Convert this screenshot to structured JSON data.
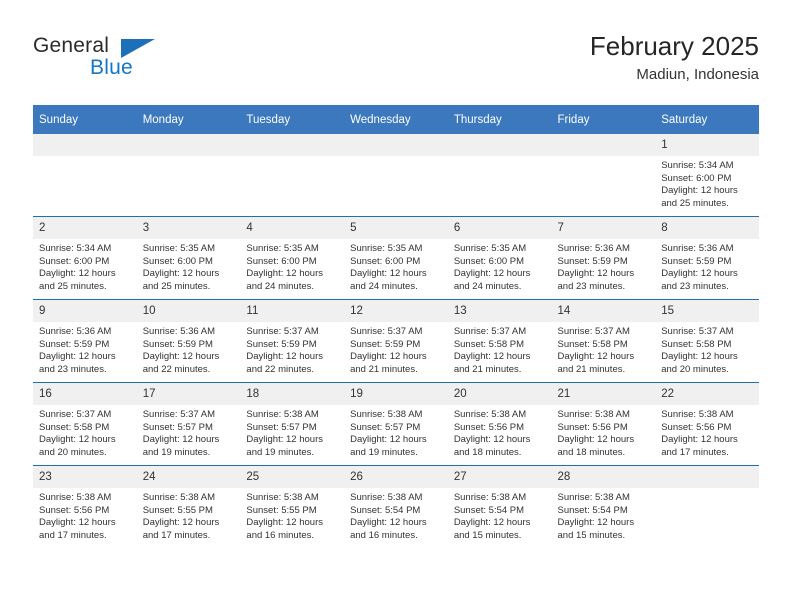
{
  "brand": {
    "name_part1": "General",
    "name_part2": "Blue",
    "logo_icon": "triangle-logo-icon",
    "accent_color": "#1D6FB8"
  },
  "header": {
    "title": "February 2025",
    "subtitle": "Madiun, Indonesia"
  },
  "theme": {
    "header_blue": "#3B78BD",
    "separator_blue": "#1F6FB5",
    "daynum_band": "#F0F0F0",
    "text": "#333333"
  },
  "calendar": {
    "weekdays": [
      "Sunday",
      "Monday",
      "Tuesday",
      "Wednesday",
      "Thursday",
      "Friday",
      "Saturday"
    ],
    "weeks": [
      [
        {
          "day": "",
          "sunrise": "",
          "sunset": "",
          "daylight_line1": "",
          "daylight_line2": "",
          "empty": true
        },
        {
          "day": "",
          "sunrise": "",
          "sunset": "",
          "daylight_line1": "",
          "daylight_line2": "",
          "empty": true
        },
        {
          "day": "",
          "sunrise": "",
          "sunset": "",
          "daylight_line1": "",
          "daylight_line2": "",
          "empty": true
        },
        {
          "day": "",
          "sunrise": "",
          "sunset": "",
          "daylight_line1": "",
          "daylight_line2": "",
          "empty": true
        },
        {
          "day": "",
          "sunrise": "",
          "sunset": "",
          "daylight_line1": "",
          "daylight_line2": "",
          "empty": true
        },
        {
          "day": "",
          "sunrise": "",
          "sunset": "",
          "daylight_line1": "",
          "daylight_line2": "",
          "empty": true
        },
        {
          "day": "1",
          "sunrise": "Sunrise: 5:34 AM",
          "sunset": "Sunset: 6:00 PM",
          "daylight_line1": "Daylight: 12 hours",
          "daylight_line2": "and 25 minutes."
        }
      ],
      [
        {
          "day": "2",
          "sunrise": "Sunrise: 5:34 AM",
          "sunset": "Sunset: 6:00 PM",
          "daylight_line1": "Daylight: 12 hours",
          "daylight_line2": "and 25 minutes."
        },
        {
          "day": "3",
          "sunrise": "Sunrise: 5:35 AM",
          "sunset": "Sunset: 6:00 PM",
          "daylight_line1": "Daylight: 12 hours",
          "daylight_line2": "and 25 minutes."
        },
        {
          "day": "4",
          "sunrise": "Sunrise: 5:35 AM",
          "sunset": "Sunset: 6:00 PM",
          "daylight_line1": "Daylight: 12 hours",
          "daylight_line2": "and 24 minutes."
        },
        {
          "day": "5",
          "sunrise": "Sunrise: 5:35 AM",
          "sunset": "Sunset: 6:00 PM",
          "daylight_line1": "Daylight: 12 hours",
          "daylight_line2": "and 24 minutes."
        },
        {
          "day": "6",
          "sunrise": "Sunrise: 5:35 AM",
          "sunset": "Sunset: 6:00 PM",
          "daylight_line1": "Daylight: 12 hours",
          "daylight_line2": "and 24 minutes."
        },
        {
          "day": "7",
          "sunrise": "Sunrise: 5:36 AM",
          "sunset": "Sunset: 5:59 PM",
          "daylight_line1": "Daylight: 12 hours",
          "daylight_line2": "and 23 minutes."
        },
        {
          "day": "8",
          "sunrise": "Sunrise: 5:36 AM",
          "sunset": "Sunset: 5:59 PM",
          "daylight_line1": "Daylight: 12 hours",
          "daylight_line2": "and 23 minutes."
        }
      ],
      [
        {
          "day": "9",
          "sunrise": "Sunrise: 5:36 AM",
          "sunset": "Sunset: 5:59 PM",
          "daylight_line1": "Daylight: 12 hours",
          "daylight_line2": "and 23 minutes."
        },
        {
          "day": "10",
          "sunrise": "Sunrise: 5:36 AM",
          "sunset": "Sunset: 5:59 PM",
          "daylight_line1": "Daylight: 12 hours",
          "daylight_line2": "and 22 minutes."
        },
        {
          "day": "11",
          "sunrise": "Sunrise: 5:37 AM",
          "sunset": "Sunset: 5:59 PM",
          "daylight_line1": "Daylight: 12 hours",
          "daylight_line2": "and 22 minutes."
        },
        {
          "day": "12",
          "sunrise": "Sunrise: 5:37 AM",
          "sunset": "Sunset: 5:59 PM",
          "daylight_line1": "Daylight: 12 hours",
          "daylight_line2": "and 21 minutes."
        },
        {
          "day": "13",
          "sunrise": "Sunrise: 5:37 AM",
          "sunset": "Sunset: 5:58 PM",
          "daylight_line1": "Daylight: 12 hours",
          "daylight_line2": "and 21 minutes."
        },
        {
          "day": "14",
          "sunrise": "Sunrise: 5:37 AM",
          "sunset": "Sunset: 5:58 PM",
          "daylight_line1": "Daylight: 12 hours",
          "daylight_line2": "and 21 minutes."
        },
        {
          "day": "15",
          "sunrise": "Sunrise: 5:37 AM",
          "sunset": "Sunset: 5:58 PM",
          "daylight_line1": "Daylight: 12 hours",
          "daylight_line2": "and 20 minutes."
        }
      ],
      [
        {
          "day": "16",
          "sunrise": "Sunrise: 5:37 AM",
          "sunset": "Sunset: 5:58 PM",
          "daylight_line1": "Daylight: 12 hours",
          "daylight_line2": "and 20 minutes."
        },
        {
          "day": "17",
          "sunrise": "Sunrise: 5:37 AM",
          "sunset": "Sunset: 5:57 PM",
          "daylight_line1": "Daylight: 12 hours",
          "daylight_line2": "and 19 minutes."
        },
        {
          "day": "18",
          "sunrise": "Sunrise: 5:38 AM",
          "sunset": "Sunset: 5:57 PM",
          "daylight_line1": "Daylight: 12 hours",
          "daylight_line2": "and 19 minutes."
        },
        {
          "day": "19",
          "sunrise": "Sunrise: 5:38 AM",
          "sunset": "Sunset: 5:57 PM",
          "daylight_line1": "Daylight: 12 hours",
          "daylight_line2": "and 19 minutes."
        },
        {
          "day": "20",
          "sunrise": "Sunrise: 5:38 AM",
          "sunset": "Sunset: 5:56 PM",
          "daylight_line1": "Daylight: 12 hours",
          "daylight_line2": "and 18 minutes."
        },
        {
          "day": "21",
          "sunrise": "Sunrise: 5:38 AM",
          "sunset": "Sunset: 5:56 PM",
          "daylight_line1": "Daylight: 12 hours",
          "daylight_line2": "and 18 minutes."
        },
        {
          "day": "22",
          "sunrise": "Sunrise: 5:38 AM",
          "sunset": "Sunset: 5:56 PM",
          "daylight_line1": "Daylight: 12 hours",
          "daylight_line2": "and 17 minutes."
        }
      ],
      [
        {
          "day": "23",
          "sunrise": "Sunrise: 5:38 AM",
          "sunset": "Sunset: 5:56 PM",
          "daylight_line1": "Daylight: 12 hours",
          "daylight_line2": "and 17 minutes."
        },
        {
          "day": "24",
          "sunrise": "Sunrise: 5:38 AM",
          "sunset": "Sunset: 5:55 PM",
          "daylight_line1": "Daylight: 12 hours",
          "daylight_line2": "and 17 minutes."
        },
        {
          "day": "25",
          "sunrise": "Sunrise: 5:38 AM",
          "sunset": "Sunset: 5:55 PM",
          "daylight_line1": "Daylight: 12 hours",
          "daylight_line2": "and 16 minutes."
        },
        {
          "day": "26",
          "sunrise": "Sunrise: 5:38 AM",
          "sunset": "Sunset: 5:54 PM",
          "daylight_line1": "Daylight: 12 hours",
          "daylight_line2": "and 16 minutes."
        },
        {
          "day": "27",
          "sunrise": "Sunrise: 5:38 AM",
          "sunset": "Sunset: 5:54 PM",
          "daylight_line1": "Daylight: 12 hours",
          "daylight_line2": "and 15 minutes."
        },
        {
          "day": "28",
          "sunrise": "Sunrise: 5:38 AM",
          "sunset": "Sunset: 5:54 PM",
          "daylight_line1": "Daylight: 12 hours",
          "daylight_line2": "and 15 minutes."
        },
        {
          "day": "",
          "sunrise": "",
          "sunset": "",
          "daylight_line1": "",
          "daylight_line2": "",
          "empty": true
        }
      ]
    ]
  }
}
